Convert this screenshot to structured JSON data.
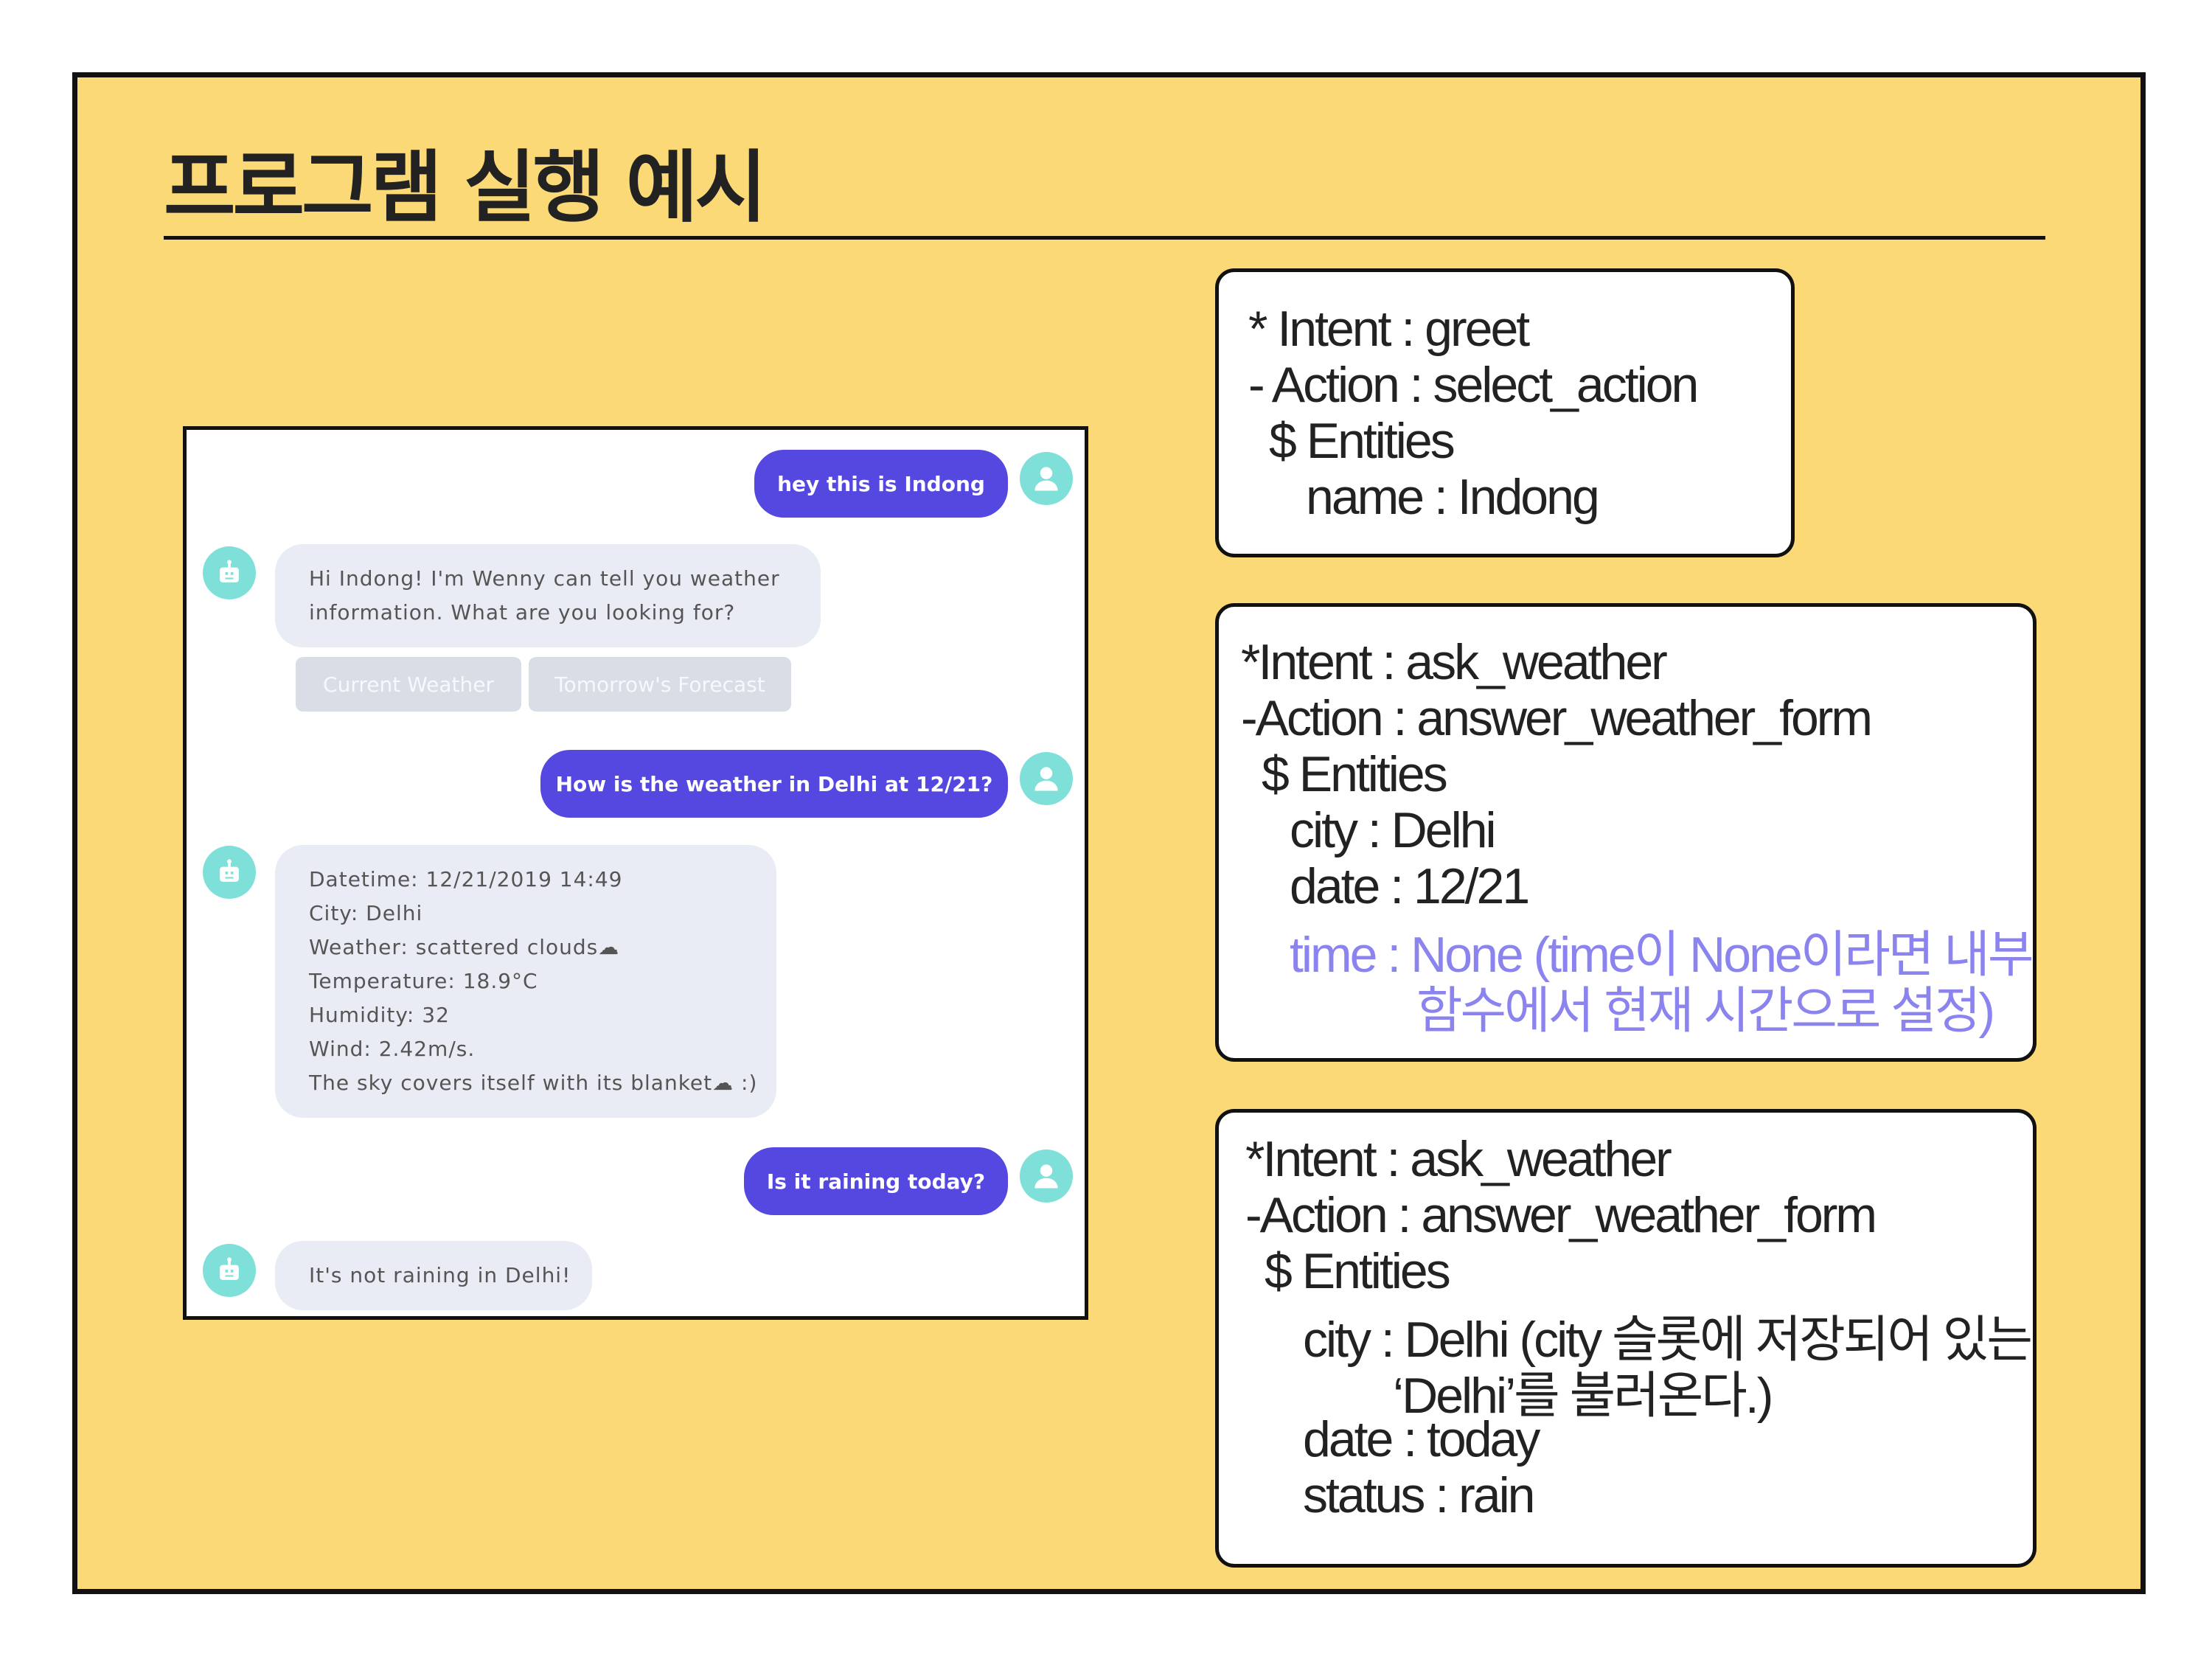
{
  "slide": {
    "title": "프로그램 실행 예시"
  },
  "colors": {
    "background": "#fbd976",
    "user_bubble": "#5548e0",
    "bot_bubble": "#eaecf5",
    "avatar": "#7ee0d8",
    "highlight": "#8b84ef"
  },
  "chat": {
    "messages": [
      {
        "from": "user",
        "text": "hey this is Indong"
      },
      {
        "from": "bot",
        "lines": [
          "Hi Indong! I'm Wenny can tell you weather",
          "information. What are you looking for?"
        ]
      },
      {
        "from": "user",
        "text": "How is the weather in Delhi at 12/21?"
      },
      {
        "from": "bot",
        "lines": [
          "Datetime: 12/21/2019 14:49",
          "City: Delhi",
          "Weather: scattered clouds☁",
          "Temperature: 18.9°C",
          "Humidity: 32",
          "Wind: 2.42m/s.",
          "The sky covers itself with its blanket☁ :)"
        ]
      },
      {
        "from": "user",
        "text": "Is it raining today?"
      },
      {
        "from": "bot",
        "lines": [
          "It's not raining in Delhi!"
        ]
      }
    ],
    "quick_replies": [
      "Current Weather",
      "Tomorrow's Forecast"
    ],
    "icons": {
      "user": "user-avatar-icon",
      "bot": "robot-avatar-icon"
    }
  },
  "boxes": [
    {
      "lines": [
        "* Intent : greet",
        "- Action : select_action",
        "$ Entities",
        "name : Indong"
      ]
    },
    {
      "lines": [
        "*Intent : ask_weather",
        "-Action : answer_weather_form",
        "$ Entities",
        "city : Delhi",
        "date : 12/21"
      ],
      "highlight_lines": [
        "time : None (time이 None이라면 내부",
        "함수에서 현재 시간으로 설정)"
      ]
    },
    {
      "lines": [
        "*Intent : ask_weather",
        "-Action : answer_weather_form",
        "$ Entities",
        "city : Delhi (city 슬롯에 저장되어 있는",
        "‘Delhi’를 불러온다.)",
        "date : today",
        "status : rain"
      ]
    }
  ]
}
